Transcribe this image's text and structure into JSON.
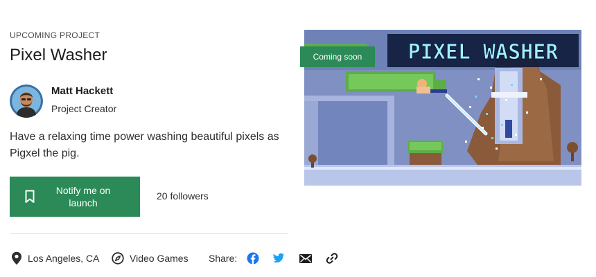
{
  "project": {
    "eyebrow": "UPCOMING PROJECT",
    "title": "Pixel Washer",
    "blurb": "Have a relaxing time power washing beautiful pixels as Pigxel the pig."
  },
  "creator": {
    "name": "Matt Hackett",
    "role": "Project Creator"
  },
  "actions": {
    "notify_label": "Notify me on launch",
    "followers": "20 followers"
  },
  "meta": {
    "location": "Los Angeles, CA",
    "category": "Video Games",
    "share_label": "Share:"
  },
  "hero": {
    "badge": "Coming soon",
    "logo_text": "PIXEL WASHER"
  },
  "icons": {
    "location": "map-pin-icon",
    "category": "compass-icon",
    "facebook": "facebook-icon",
    "twitter": "twitter-icon",
    "email": "email-icon",
    "link": "link-icon",
    "bookmark": "bookmark-icon"
  },
  "colors": {
    "accent": "#2b8a57",
    "facebook": "#1877f2",
    "twitter": "#1da1f2",
    "text": "#1c1c1c"
  }
}
